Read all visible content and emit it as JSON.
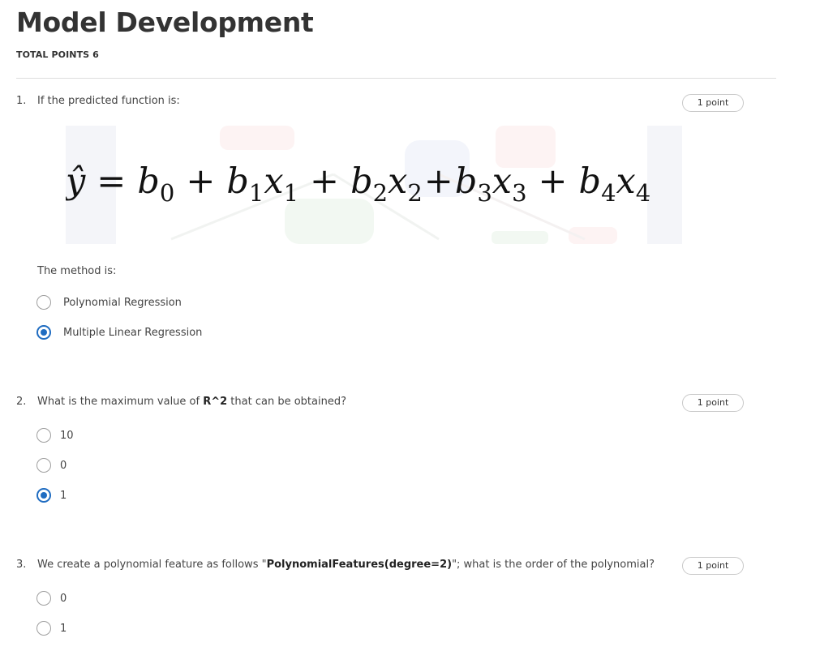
{
  "page": {
    "title": "Model Development",
    "total_points": "TOTAL POINTS 6"
  },
  "colors": {
    "accent": "#1f6cc1",
    "text": "#444444",
    "divider": "#dddddd"
  },
  "questions": [
    {
      "number": "1.",
      "prompt": "If the predicted function is:",
      "points": "1 point",
      "formula": {
        "lhs": "ŷ",
        "equals": "=",
        "terms": [
          {
            "coef": "b",
            "coef_sub": "0"
          },
          {
            "coef": "b",
            "coef_sub": "1",
            "var": "x",
            "var_sub": "1"
          },
          {
            "coef": "b",
            "coef_sub": "2",
            "var": "x",
            "var_sub": "2"
          },
          {
            "coef": "b",
            "coef_sub": "3",
            "var": "x",
            "var_sub": "3"
          },
          {
            "coef": "b",
            "coef_sub": "4",
            "var": "x",
            "var_sub": "4"
          }
        ],
        "plus": "+"
      },
      "sub_prompt": "The method is:",
      "options": [
        {
          "label": "Polynomial Regression",
          "selected": false
        },
        {
          "label": "Multiple Linear Regression",
          "selected": true
        }
      ]
    },
    {
      "number": "2.",
      "prompt_before": "What is the maximum value of ",
      "prompt_bold": "R^2",
      "prompt_after": " that can be obtained?",
      "points": "1 point",
      "options": [
        {
          "label": "10",
          "selected": false
        },
        {
          "label": "0",
          "selected": false
        },
        {
          "label": "1",
          "selected": true
        }
      ]
    },
    {
      "number": "3.",
      "prompt_before": "We create a polynomial feature as follows \"",
      "prompt_bold": "PolynomialFeatures(degree=2)",
      "prompt_after": "\"; what is the order of the polynomial?",
      "points": "1 point",
      "options": [
        {
          "label": "0",
          "selected": false
        },
        {
          "label": "1",
          "selected": false
        }
      ]
    }
  ]
}
